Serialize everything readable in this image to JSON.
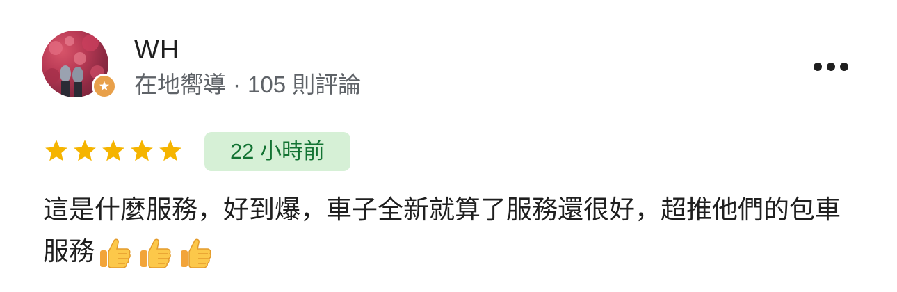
{
  "review": {
    "user": {
      "name": "WH",
      "role": "在地嚮導",
      "separator": "·",
      "review_count": "105 則評論",
      "avatar_icon": "user-avatar-photo",
      "badge_icon": "local-guide-star-badge"
    },
    "more_icon": "more-horizontal-icon",
    "rating": 5,
    "rating_max": 5,
    "star_color": "#f5b400",
    "time_ago": "22 小時前",
    "time_badge_bg": "#d6f0d6",
    "time_badge_color": "#137333",
    "body_text": "這是什麼服務，好到爆，車子全新就算了服務還很好，超推他們的包車服務",
    "emojis": [
      "thumbs-up-icon",
      "thumbs-up-icon",
      "thumbs-up-icon"
    ]
  }
}
